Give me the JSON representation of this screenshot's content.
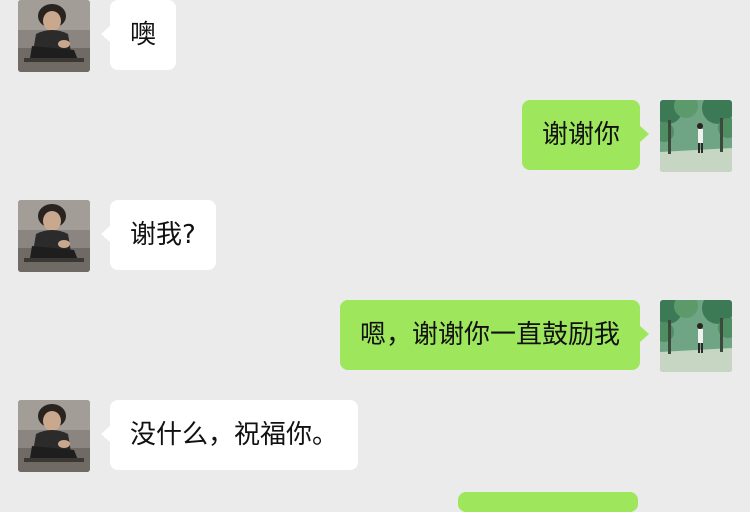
{
  "colors": {
    "background": "#ebebeb",
    "incoming_bubble": "#ffffff",
    "outgoing_bubble": "#9ee65c"
  },
  "messages": [
    {
      "side": "left",
      "text": "噢",
      "avatar": "male-avatar"
    },
    {
      "side": "right",
      "text": "谢谢你",
      "avatar": "female-avatar"
    },
    {
      "side": "left",
      "text": "谢我?",
      "avatar": "male-avatar"
    },
    {
      "side": "right",
      "text": "嗯，谢谢你一直鼓励我",
      "avatar": "female-avatar"
    },
    {
      "side": "left",
      "text": "没什么，祝福你。",
      "avatar": "male-avatar"
    }
  ]
}
